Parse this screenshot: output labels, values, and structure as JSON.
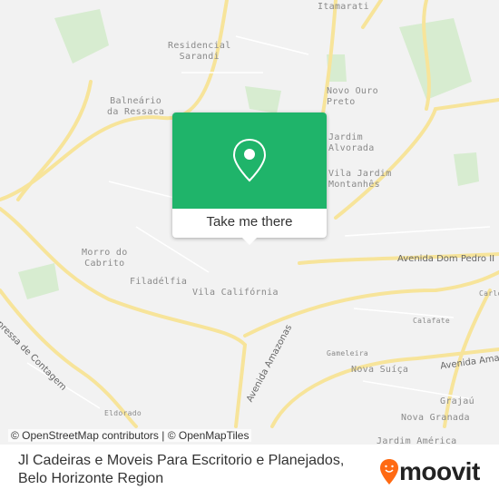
{
  "map": {
    "neighborhoods": [
      {
        "name": "Itamarati"
      },
      {
        "name": "Residencial\nSarandi"
      },
      {
        "name": "Balneário\nda Ressaca"
      },
      {
        "name": "Novo Ouro\nPreto"
      },
      {
        "name": "Jardim\nAlvorada"
      },
      {
        "name": "Vila Jardim\nMontanhês"
      },
      {
        "name": "Morro do\nCabrito"
      },
      {
        "name": "Filadélfia"
      },
      {
        "name": "Vila Califórnia"
      },
      {
        "name": "Calafate"
      },
      {
        "name": "Gameleira"
      },
      {
        "name": "Nova Suíça"
      },
      {
        "name": "Grajaú"
      },
      {
        "name": "Nova Granada"
      },
      {
        "name": "Eldorado"
      },
      {
        "name": "Jardim América"
      },
      {
        "name": "Carlos"
      }
    ],
    "roads": [
      {
        "name": "Avenida Dom Pedro II"
      },
      {
        "name": "Avenida Amazonas"
      },
      {
        "name": "Avenida Amazonas"
      },
      {
        "name": "Via Expressa de Contagem"
      }
    ],
    "attribution": "© OpenStreetMap contributors | © OpenMapTiles",
    "colors": {
      "road": "#f7e49a",
      "park": "#d7ecd0",
      "background": "#f2f2f2",
      "accent": "#1fb46a"
    }
  },
  "popup": {
    "icon": "map-pin-icon",
    "button_label": "Take me there"
  },
  "footer": {
    "title_line1": "Jl Cadeiras e Moveis Para Escritorio e Planejados,",
    "title_line2": "Belo Horizonte Region",
    "brand": "moovit",
    "brand_color": "#ff6a13"
  }
}
